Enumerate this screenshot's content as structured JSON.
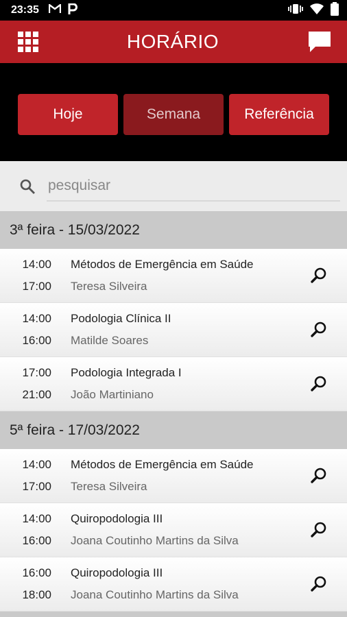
{
  "status_bar": {
    "time": "23:35",
    "icons": [
      "gmail-icon",
      "parking-icon"
    ],
    "right_icons": [
      "vibrate-icon",
      "wifi-icon",
      "battery-icon"
    ]
  },
  "app_bar": {
    "title": "HORÁRIO",
    "menu_icon": "apps-grid-icon",
    "chat_icon": "chat-icon"
  },
  "tabs": [
    {
      "label": "Hoje",
      "active": false
    },
    {
      "label": "Semana",
      "active": true
    },
    {
      "label": "Referência",
      "active": false
    }
  ],
  "search": {
    "placeholder": "pesquisar",
    "value": ""
  },
  "colors": {
    "brand": "#b51e24",
    "tab_active": "#8a1a1e"
  },
  "days": [
    {
      "header": "3ª feira - 15/03/2022",
      "events": [
        {
          "start": "14:00",
          "end": "17:00",
          "course": "Métodos de Emergência em Saúde",
          "teacher": "Teresa Silveira"
        },
        {
          "start": "14:00",
          "end": "16:00",
          "course": "Podologia Clínica II",
          "teacher": "Matilde Soares"
        },
        {
          "start": "17:00",
          "end": "21:00",
          "course": "Podologia Integrada I",
          "teacher": "João Martiniano"
        }
      ]
    },
    {
      "header": "5ª feira - 17/03/2022",
      "events": [
        {
          "start": "14:00",
          "end": "17:00",
          "course": "Métodos de Emergência em Saúde",
          "teacher": "Teresa Silveira"
        },
        {
          "start": "14:00",
          "end": "16:00",
          "course": "Quiropodologia III",
          "teacher": "Joana Coutinho Martins da Silva"
        },
        {
          "start": "16:00",
          "end": "18:00",
          "course": "Quiropodologia III",
          "teacher": "Joana Coutinho Martins da Silva"
        }
      ]
    }
  ]
}
